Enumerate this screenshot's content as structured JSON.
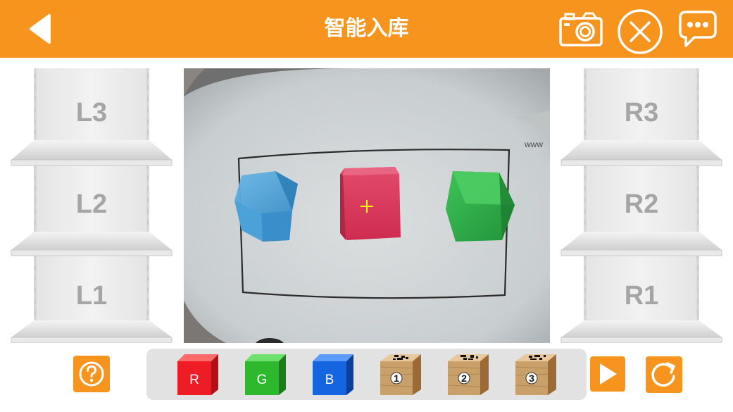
{
  "header": {
    "title": "智能入库",
    "background_color": "#f7941d",
    "icons": [
      "back-arrow-icon",
      "camera-icon",
      "close-icon",
      "chat-icon"
    ]
  },
  "left_shelf": {
    "slots": [
      {
        "label": "L3"
      },
      {
        "label": "L2"
      },
      {
        "label": "L1"
      }
    ]
  },
  "right_shelf": {
    "slots": [
      {
        "label": "R3"
      },
      {
        "label": "R2"
      },
      {
        "label": "R1"
      }
    ]
  },
  "camera_feed": {
    "blocks": [
      {
        "color": "blue",
        "hex": "#3b9bd6"
      },
      {
        "color": "red",
        "hex": "#e03a5c"
      },
      {
        "color": "green",
        "hex": "#2fb344"
      }
    ],
    "board_text": "www",
    "crosshair_color": "#ffff00"
  },
  "palette": {
    "items": [
      {
        "kind": "color-cube",
        "label": "R",
        "color": "#ee1c24"
      },
      {
        "kind": "color-cube",
        "label": "G",
        "color": "#2eb82e"
      },
      {
        "kind": "color-cube",
        "label": "B",
        "color": "#1565e0"
      },
      {
        "kind": "tag-cube",
        "label": "1"
      },
      {
        "kind": "tag-cube",
        "label": "2"
      },
      {
        "kind": "tag-cube",
        "label": "3"
      }
    ]
  },
  "controls": {
    "icons": [
      "help-icon",
      "play-icon",
      "reset-icon"
    ],
    "accent_color": "#f7941d"
  }
}
